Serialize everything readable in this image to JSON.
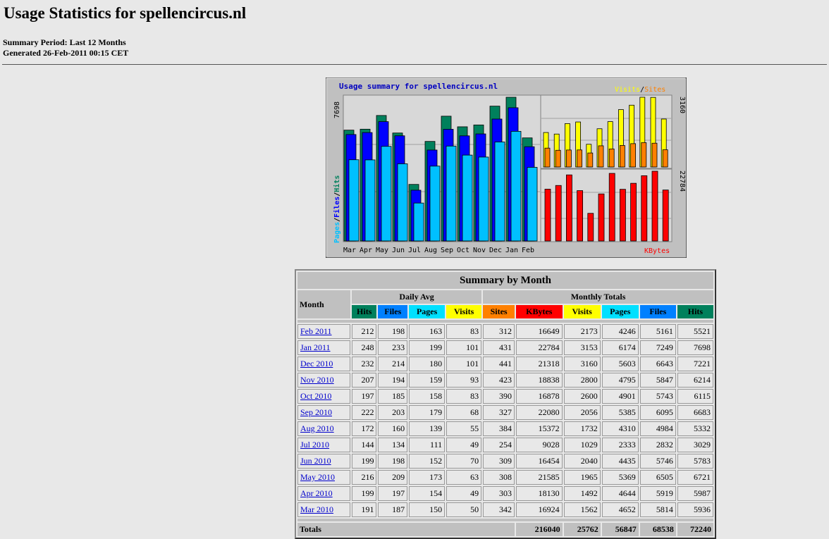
{
  "page": {
    "title": "Usage Statistics for spellencircus.nl",
    "period": "Summary Period: Last 12 Months",
    "generated": "Generated 26-Feb-2011 00:15 CET"
  },
  "chart": {
    "title": "Usage summary for spellencircus.nl",
    "legend_visits": "Visits",
    "legend_slash": "/",
    "legend_sites": "Sites",
    "left_axis_pages": "Pages",
    "left_axis_files": "Files",
    "left_axis_hits": "Hits",
    "left_max": "7698",
    "right_top_max": "3160",
    "right_bottom_max": "22784",
    "kbytes_label": "KBytes",
    "colors": {
      "hits": "#00805c",
      "files": "#0000ff",
      "pages": "#00c0ff",
      "visits": "#ffff00",
      "sites": "#ff8000",
      "kbytes": "#ff0000",
      "title": "#0000c0",
      "panel": "#c0c0c0",
      "plot": "#d8d8d8"
    }
  },
  "chart_data": {
    "type": "bar",
    "title": "Usage summary for spellencircus.nl",
    "categories": [
      "Mar",
      "Apr",
      "May",
      "Jun",
      "Jul",
      "Aug",
      "Sep",
      "Oct",
      "Nov",
      "Dec",
      "Jan",
      "Feb"
    ],
    "series": [
      {
        "name": "Hits",
        "values": [
          5936,
          5987,
          6721,
          5783,
          3029,
          5332,
          6683,
          6115,
          6214,
          7221,
          7698,
          5521
        ]
      },
      {
        "name": "Files",
        "values": [
          5814,
          5919,
          6505,
          5746,
          2832,
          4984,
          6095,
          5743,
          5847,
          6643,
          7249,
          5161
        ]
      },
      {
        "name": "Pages",
        "values": [
          4652,
          4644,
          5369,
          4435,
          2333,
          4310,
          5385,
          4901,
          4795,
          5603,
          6174,
          4246
        ]
      },
      {
        "name": "Visits",
        "values": [
          1562,
          1492,
          1965,
          2040,
          1029,
          1732,
          2056,
          2600,
          2800,
          3160,
          3153,
          2173
        ]
      },
      {
        "name": "Sites",
        "values": [
          342,
          303,
          308,
          309,
          254,
          384,
          327,
          390,
          423,
          441,
          431,
          312
        ]
      },
      {
        "name": "KBytes",
        "values": [
          16924,
          18130,
          21585,
          16454,
          9028,
          15372,
          22080,
          16878,
          18838,
          21318,
          22784,
          16649
        ]
      }
    ],
    "ylim_main": [
      0,
      7698
    ],
    "ylim_visits": [
      0,
      3160
    ],
    "ylim_kbytes": [
      0,
      22784
    ]
  },
  "table": {
    "caption": "Summary by Month",
    "month_header": "Month",
    "daily_avg_header": "Daily Avg",
    "monthly_totals_header": "Monthly Totals",
    "daily_cols": [
      {
        "label": "Hits",
        "color": "#00805c",
        "text": "#000000"
      },
      {
        "label": "Files",
        "color": "#0080ff",
        "text": "#000000"
      },
      {
        "label": "Pages",
        "color": "#00e0ff",
        "text": "#000000"
      },
      {
        "label": "Visits",
        "color": "#ffff00",
        "text": "#000000"
      }
    ],
    "monthly_cols": [
      {
        "label": "Sites",
        "color": "#ff8000",
        "text": "#000000"
      },
      {
        "label": "KBytes",
        "color": "#ff0000",
        "text": "#000000"
      },
      {
        "label": "Visits",
        "color": "#ffff00",
        "text": "#000000"
      },
      {
        "label": "Pages",
        "color": "#00e0ff",
        "text": "#000000"
      },
      {
        "label": "Files",
        "color": "#0080ff",
        "text": "#000000"
      },
      {
        "label": "Hits",
        "color": "#00805c",
        "text": "#000000"
      }
    ],
    "rows": [
      {
        "month": "Feb 2011",
        "d": [
          "212",
          "198",
          "163",
          "83"
        ],
        "m": [
          "312",
          "16649",
          "2173",
          "4246",
          "5161",
          "5521"
        ]
      },
      {
        "month": "Jan 2011",
        "d": [
          "248",
          "233",
          "199",
          "101"
        ],
        "m": [
          "431",
          "22784",
          "3153",
          "6174",
          "7249",
          "7698"
        ]
      },
      {
        "month": "Dec 2010",
        "d": [
          "232",
          "214",
          "180",
          "101"
        ],
        "m": [
          "441",
          "21318",
          "3160",
          "5603",
          "6643",
          "7221"
        ]
      },
      {
        "month": "Nov 2010",
        "d": [
          "207",
          "194",
          "159",
          "93"
        ],
        "m": [
          "423",
          "18838",
          "2800",
          "4795",
          "5847",
          "6214"
        ]
      },
      {
        "month": "Oct 2010",
        "d": [
          "197",
          "185",
          "158",
          "83"
        ],
        "m": [
          "390",
          "16878",
          "2600",
          "4901",
          "5743",
          "6115"
        ]
      },
      {
        "month": "Sep 2010",
        "d": [
          "222",
          "203",
          "179",
          "68"
        ],
        "m": [
          "327",
          "22080",
          "2056",
          "5385",
          "6095",
          "6683"
        ]
      },
      {
        "month": "Aug 2010",
        "d": [
          "172",
          "160",
          "139",
          "55"
        ],
        "m": [
          "384",
          "15372",
          "1732",
          "4310",
          "4984",
          "5332"
        ]
      },
      {
        "month": "Jul 2010",
        "d": [
          "144",
          "134",
          "111",
          "49"
        ],
        "m": [
          "254",
          "9028",
          "1029",
          "2333",
          "2832",
          "3029"
        ]
      },
      {
        "month": "Jun 2010",
        "d": [
          "199",
          "198",
          "152",
          "70"
        ],
        "m": [
          "309",
          "16454",
          "2040",
          "4435",
          "5746",
          "5783"
        ]
      },
      {
        "month": "May 2010",
        "d": [
          "216",
          "209",
          "173",
          "63"
        ],
        "m": [
          "308",
          "21585",
          "1965",
          "5369",
          "6505",
          "6721"
        ]
      },
      {
        "month": "Apr 2010",
        "d": [
          "199",
          "197",
          "154",
          "49"
        ],
        "m": [
          "303",
          "18130",
          "1492",
          "4644",
          "5919",
          "5987"
        ]
      },
      {
        "month": "Mar 2010",
        "d": [
          "191",
          "187",
          "150",
          "50"
        ],
        "m": [
          "342",
          "16924",
          "1562",
          "4652",
          "5814",
          "5936"
        ]
      }
    ],
    "totals_label": "Totals",
    "totals": [
      "216040",
      "25762",
      "56847",
      "68538",
      "72240"
    ]
  }
}
